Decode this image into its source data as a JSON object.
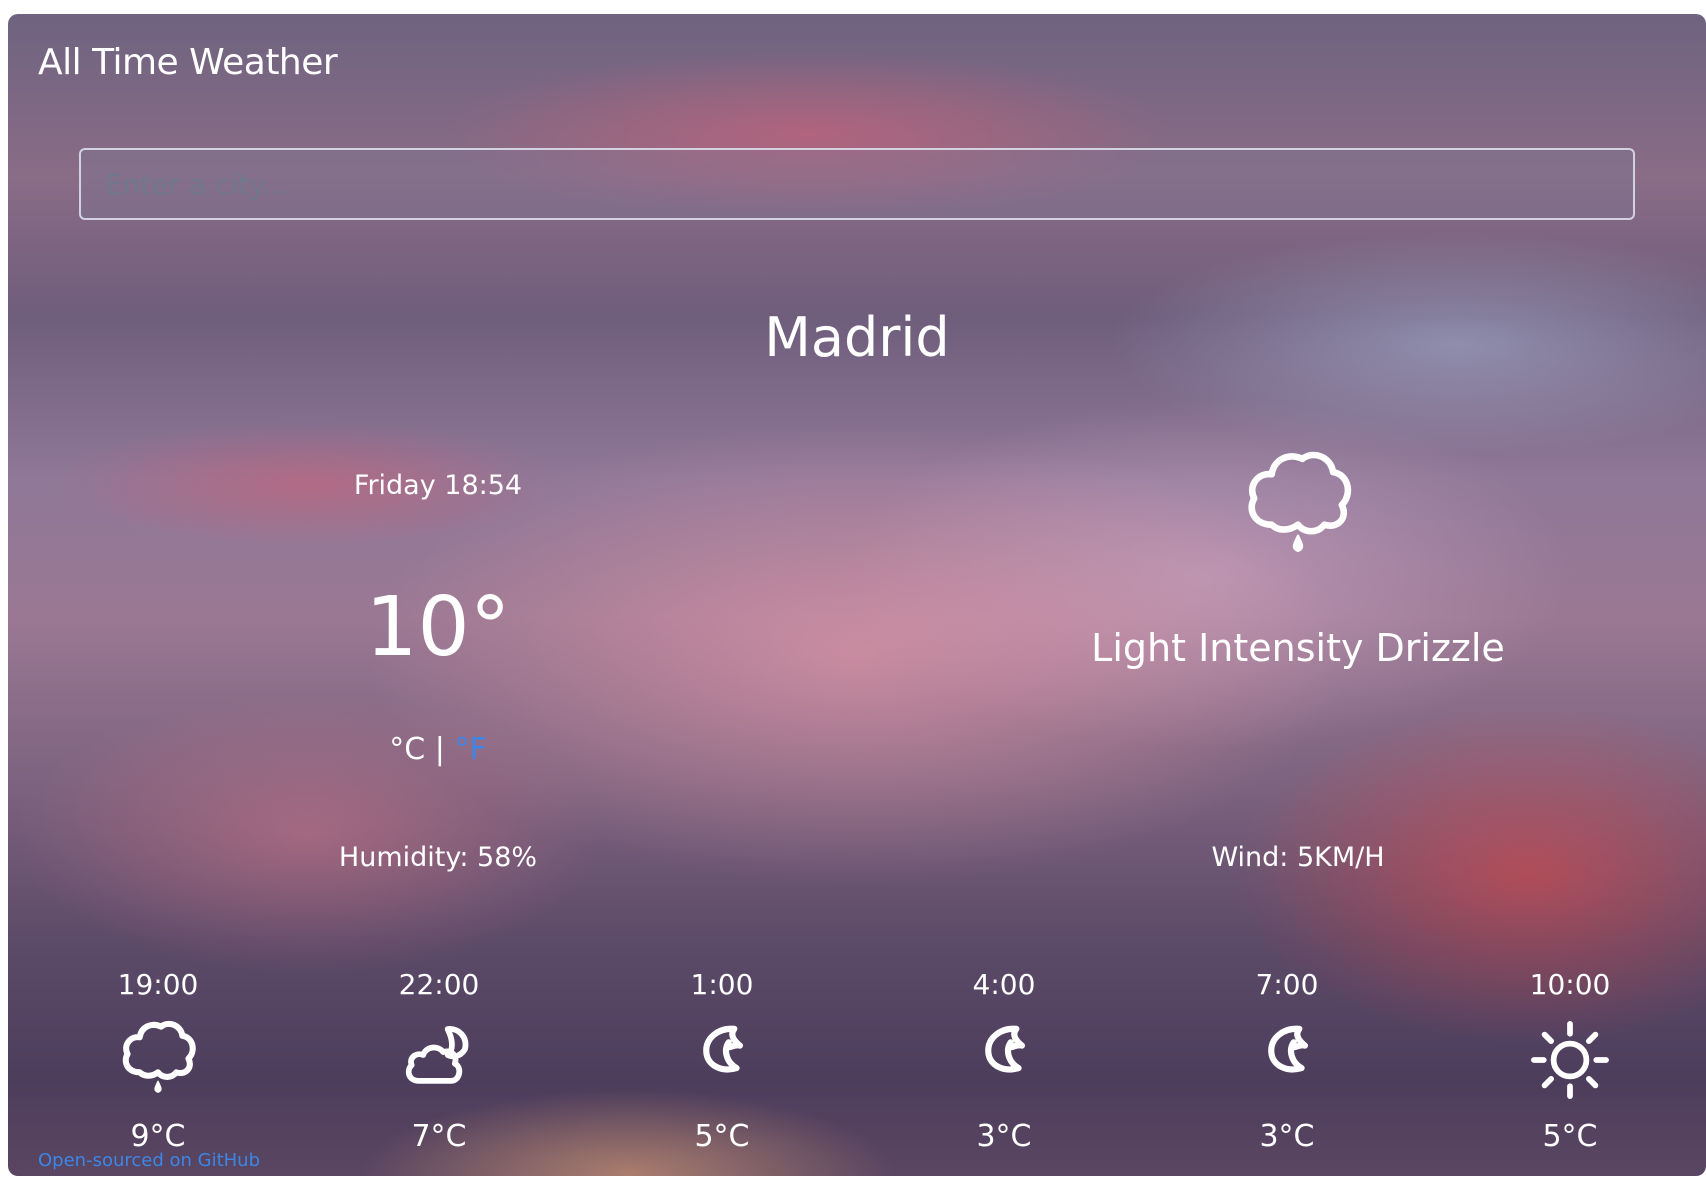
{
  "app": {
    "title": "All Time Weather"
  },
  "search": {
    "placeholder": "Enter a city..."
  },
  "current": {
    "city": "Madrid",
    "day_time": "Friday 18:54",
    "temperature": "10°",
    "unit_celsius": "°C",
    "unit_separator": "|",
    "unit_fahrenheit": "°F",
    "humidity": "Humidity: 58%",
    "wind": "Wind: 5KM/H",
    "condition": "Light Intensity Drizzle",
    "condition_icon": "drizzle-icon"
  },
  "forecast": [
    {
      "time": "19:00",
      "temp": "9°C",
      "icon": "drizzle-icon"
    },
    {
      "time": "22:00",
      "temp": "7°C",
      "icon": "cloud-moon-icon"
    },
    {
      "time": "1:00",
      "temp": "5°C",
      "icon": "moon-icon"
    },
    {
      "time": "4:00",
      "temp": "3°C",
      "icon": "moon-icon"
    },
    {
      "time": "7:00",
      "temp": "3°C",
      "icon": "moon-icon"
    },
    {
      "time": "10:00",
      "temp": "5°C",
      "icon": "sun-icon"
    }
  ],
  "footer": {
    "github_link": "Open-sourced on GitHub"
  },
  "colors": {
    "link": "#3d86e6",
    "text": "#ffffff"
  }
}
